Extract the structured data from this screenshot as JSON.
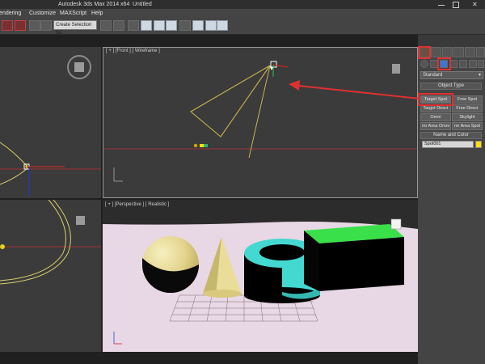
{
  "window": {
    "app_title": "Autodesk 3ds Max  2014 x64",
    "doc_title": "Untitled"
  },
  "menu": {
    "rendering": "Rendering",
    "customize": "Customize",
    "maxscript": "MAXScript",
    "help": "Help"
  },
  "toolbar": {
    "selection_set": "Create Selection Se"
  },
  "viewports": {
    "front": {
      "label": "[ + ] [Front ] [ Wireframe ]"
    },
    "perspective": {
      "label": "[ + ] [Perspective ] [ Realistic ]"
    }
  },
  "command_panel": {
    "category": "Standard",
    "object_type_header": "Object Type",
    "buttons": [
      "Target Spot",
      "Free Spot",
      "Target Direct",
      "Free Direct",
      "Omni",
      "Skylight",
      "mr Area Omni",
      "mr Area Spot"
    ],
    "name_color_header": "Name and Color",
    "name_value": "Spot001"
  },
  "colors": {
    "accent_highlight": "#e03030",
    "light_color": "#ffe000",
    "cube_top": "#39e04a",
    "cylinder": "#43d8d0",
    "sphere": "#efe2a0",
    "cone": "#e9dd99"
  }
}
